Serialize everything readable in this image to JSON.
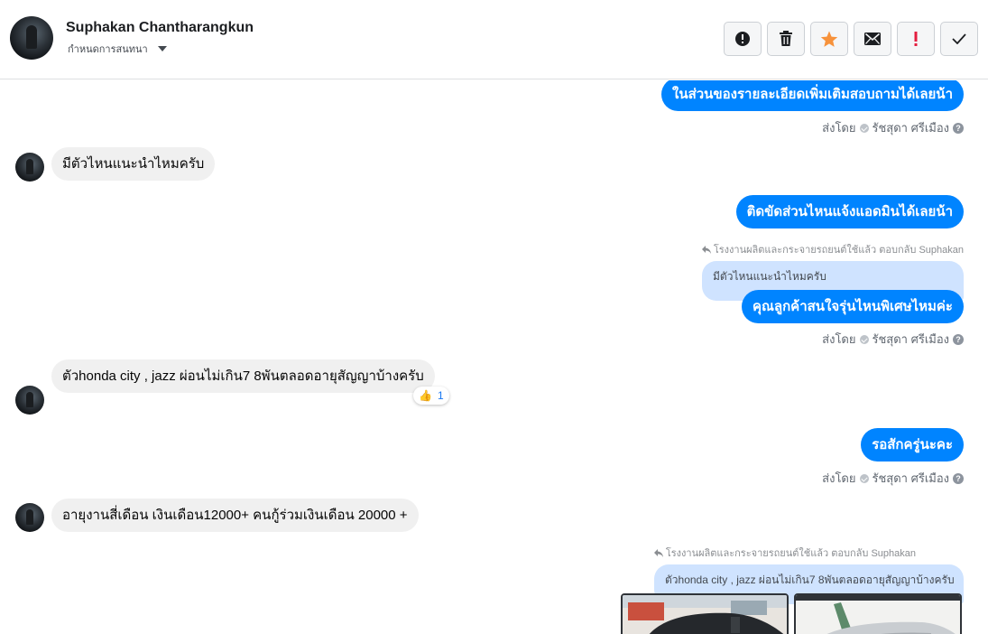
{
  "header": {
    "name": "Suphakan Chantharangkun",
    "subtitle": "กำหนดการสนทนา"
  },
  "toolbar": [
    {
      "name": "spam-button",
      "icon": "alert-circle-icon"
    },
    {
      "name": "delete-button",
      "icon": "trash-icon"
    },
    {
      "name": "star-button",
      "icon": "star-icon",
      "color": "#f7923b"
    },
    {
      "name": "mark-unread-button",
      "icon": "envelope-icon"
    },
    {
      "name": "important-button",
      "icon": "exclamation-icon",
      "color": "#e41e3f"
    },
    {
      "name": "mark-done-button",
      "icon": "check-icon"
    }
  ],
  "messages": {
    "m1": "ในส่วนของรายละเอียดเพิ่มเติมสอบถามได้เลยน้า",
    "m2": "มีตัวไหนแนะนำไหมครับ",
    "m3": "ติดขัดส่วนไหนแจ้งแอดมินได้เลยน้า",
    "m4": "คุณลูกค้าสนใจรุ่นไหนพิเศษไหมค่ะ",
    "m5": "ตัวhonda city , jazz ผ่อนไม่เกิน7 8พันตลอดอายุสัญญาบ้างครับ",
    "m6": "รอสักครู่นะคะ",
    "m7": "อายุงานสี่เดือน เงินเดือน12000+ คนกู้ร่วมเงินเดือน 20000 +"
  },
  "sent_by": {
    "label": "ส่งโดย",
    "agent": "รัชสุดา ศรีเมือง"
  },
  "reply_note": "โรงงานผลิตและกระจายรถยนต์ใช้แล้ว ตอบกลับ Suphakan",
  "quotes": {
    "q1": "มีตัวไหนแนะนำไหมครับ",
    "q2": "ตัวhonda city , jazz ผ่อนไม่เกิน7 8พันตลอดอายุสัญญาบ้างครับ"
  },
  "reaction": {
    "emoji": "👍",
    "count": "1"
  },
  "colors": {
    "outgoing": "#0084ff",
    "incoming": "#f0f0f0",
    "quote": "#cfe3ff"
  }
}
